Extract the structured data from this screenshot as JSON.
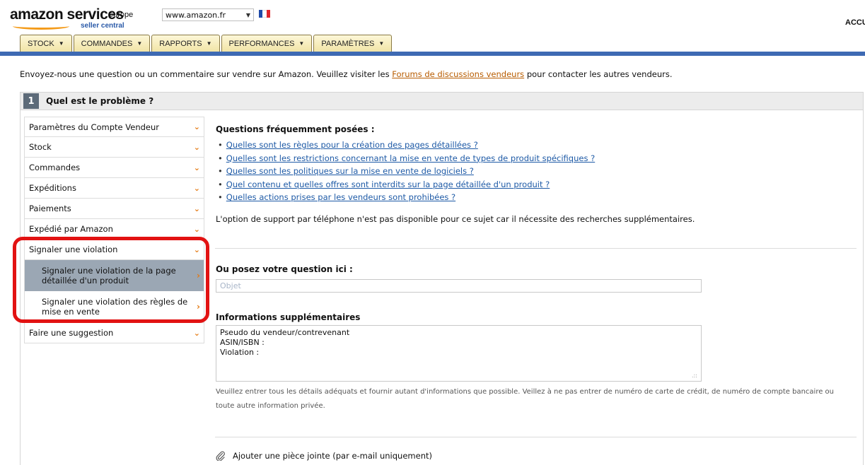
{
  "header": {
    "logo_main": "amazon services",
    "logo_region": "europe",
    "logo_sub": "seller central",
    "site_selector": "www.amazon.fr",
    "account_text": "ACCU",
    "flag_colors": [
      "#1f4aa8",
      "#ffffff",
      "#e0262b"
    ]
  },
  "nav": {
    "tabs": [
      {
        "label": "STOCK"
      },
      {
        "label": "COMMANDES"
      },
      {
        "label": "RAPPORTS"
      },
      {
        "label": "PERFORMANCES"
      },
      {
        "label": "PARAMÈTRES"
      }
    ]
  },
  "intro": {
    "before": "Envoyez-nous une question ou un commentaire sur vendre sur Amazon. Veuillez visiter les ",
    "link": "Forums de discussions vendeurs",
    "after": " pour contacter les autres vendeurs."
  },
  "section": {
    "number": "1",
    "title": "Quel est le problème ?"
  },
  "menu": {
    "items": [
      {
        "label": "Paramètres du Compte Vendeur"
      },
      {
        "label": "Stock"
      },
      {
        "label": "Commandes"
      },
      {
        "label": "Expéditions"
      },
      {
        "label": "Paiements"
      },
      {
        "label": "Expédié par Amazon"
      },
      {
        "label": "Signaler une violation"
      }
    ],
    "sub_items": [
      {
        "label": "Signaler une violation de la page détaillée d'un produit"
      },
      {
        "label": "Signaler une violation des règles de mise en vente"
      }
    ],
    "last_item": "Faire une suggestion"
  },
  "faq": {
    "title": "Questions fréquemment posées :",
    "links": [
      "Quelles sont les règles pour la création des pages détaillées ?",
      "Quelles sont les restrictions concernant la mise en vente de types de produit spécifiques ?",
      "Quelles sont les politiques sur la mise en vente de logiciels ?",
      "Quel contenu et quelles offres sont interdits sur la page détaillée d'un produit ?",
      "Quelles actions prises par les vendeurs sont prohibées ?"
    ],
    "phone_note": "L'option de support par téléphone n'est pas disponible pour ce sujet car il nécessite des recherches supplémentaires."
  },
  "form": {
    "question_label": "Ou posez votre question ici :",
    "question_placeholder": "Objet",
    "info_label": "Informations supplémentaires",
    "info_value": "Pseudo du vendeur/contrevenant\nASIN/ISBN :\nViolation :",
    "help_text": "Veuillez entrer tous les détails adéquats et fournir autant d'informations que possible. Veillez à ne pas entrer de numéro de carte de crédit, de numéro de compte bancaire ou toute autre information privée.",
    "attach_label": "Ajouter une pièce jointe (par e-mail uniquement)"
  },
  "colors": {
    "nav_bar": "#3e6ab3",
    "highlight": "#e21212",
    "link": "#1e5aa6",
    "chevron": "#e47911"
  }
}
